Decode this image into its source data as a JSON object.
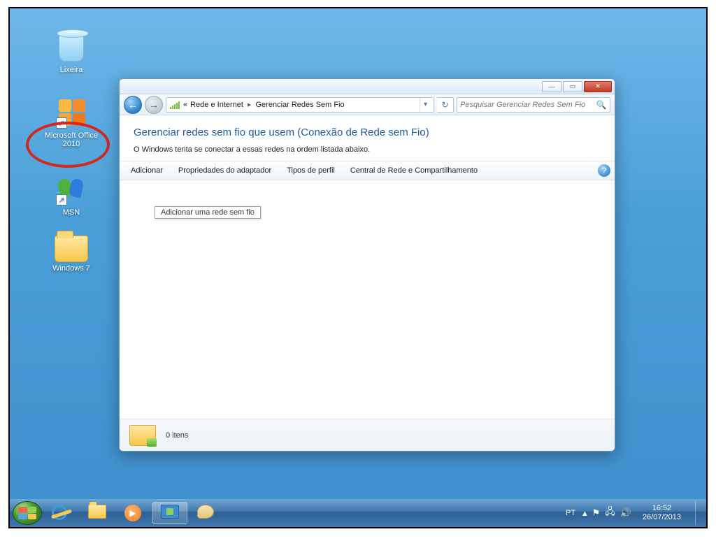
{
  "desktop": {
    "icons": [
      {
        "name": "recycle-bin",
        "label": "Lixeira"
      },
      {
        "name": "ms-office",
        "label": "Microsoft Office 2010"
      },
      {
        "name": "msn",
        "label": "MSN"
      },
      {
        "name": "windows7",
        "label": "Windows 7"
      }
    ]
  },
  "window": {
    "breadcrumb": {
      "prefix": "«",
      "part1": "Rede e Internet",
      "part2": "Gerenciar Redes Sem Fio"
    },
    "search_placeholder": "Pesquisar Gerenciar Redes Sem Fio",
    "title": "Gerenciar redes sem fio que usem (Conexão de Rede sem Fio)",
    "subtitle": "O Windows tenta se conectar a essas redes na ordem listada abaixo.",
    "toolbar": {
      "add": "Adicionar",
      "adapter_props": "Propriedades do adaptador",
      "profile_types": "Tipos de perfil",
      "network_center": "Central de Rede e Compartilhamento"
    },
    "tooltip": "Adicionar uma rede sem fio",
    "status": "0 itens"
  },
  "taskbar": {
    "language": "PT",
    "time": "16:52",
    "date": "26/07/2013"
  }
}
